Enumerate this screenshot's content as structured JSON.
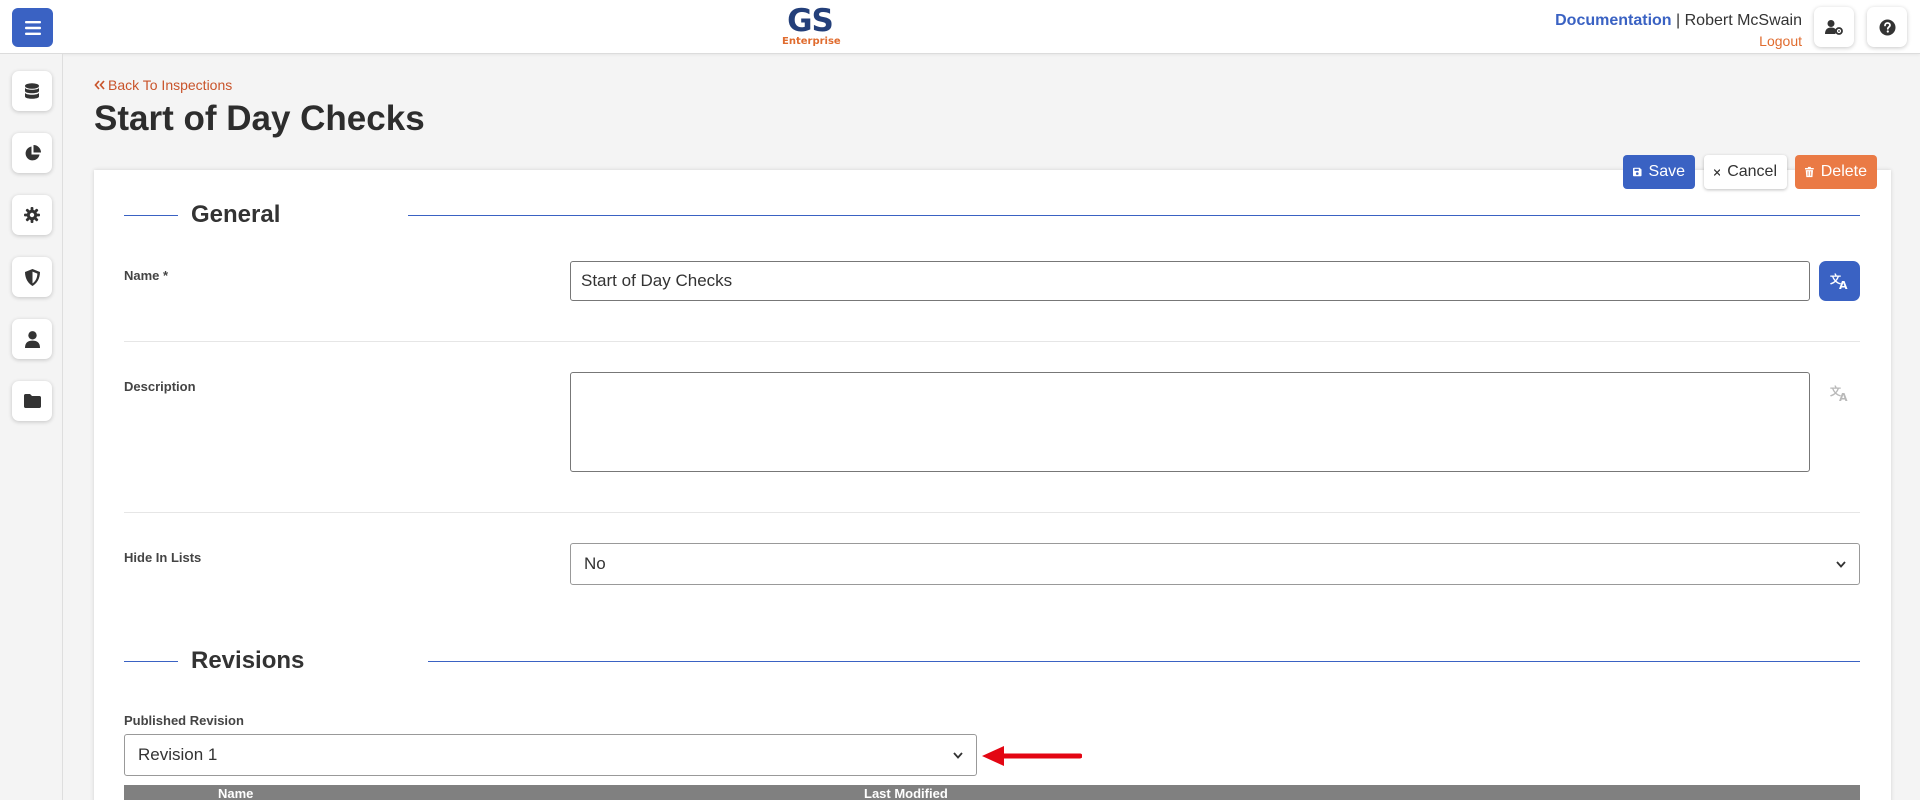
{
  "header": {
    "logo_main": "GS",
    "logo_sub": "Enterprise",
    "documentation_link": "Documentation",
    "separator": "|",
    "user_name": "Robert McSwain",
    "logout_link": "Logout"
  },
  "sidebar": {
    "items": [
      {
        "icon": "database-icon"
      },
      {
        "icon": "pie-chart-icon"
      },
      {
        "icon": "gear-icon"
      },
      {
        "icon": "shield-icon"
      },
      {
        "icon": "user-icon"
      },
      {
        "icon": "folder-icon"
      }
    ]
  },
  "page": {
    "back_link": "Back To Inspections",
    "title": "Start of Day Checks"
  },
  "toolbar": {
    "save_label": "Save",
    "cancel_label": "Cancel",
    "delete_label": "Delete"
  },
  "general": {
    "section_title": "General",
    "name_label": "Name *",
    "name_value": "Start of Day Checks",
    "description_label": "Description",
    "description_value": "",
    "hide_label": "Hide In Lists",
    "hide_value": "No"
  },
  "revisions": {
    "section_title": "Revisions",
    "published_label": "Published Revision",
    "published_value": "Revision 1",
    "table_headers": [
      "Name",
      "Last Modified"
    ]
  },
  "colors": {
    "primary": "#3a62c3",
    "accent": "#e06c2f",
    "delete": "#ea7a45",
    "arrow": "#e30613"
  }
}
